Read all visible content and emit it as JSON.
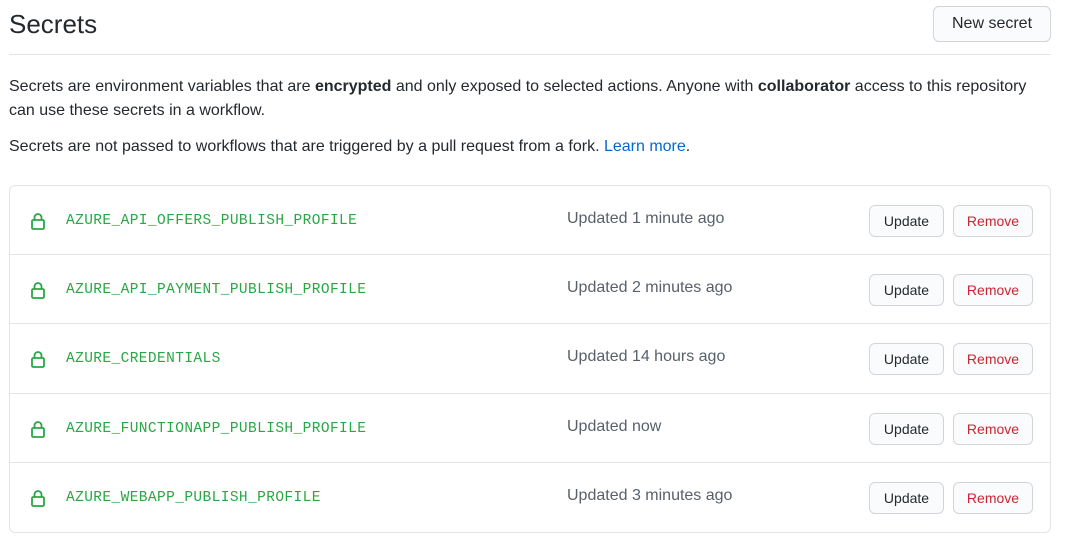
{
  "header": {
    "title": "Secrets",
    "new_secret_label": "New secret"
  },
  "description": {
    "p1_part1": "Secrets are environment variables that are ",
    "p1_bold1": "encrypted",
    "p1_part2": " and only exposed to selected actions. Anyone with ",
    "p1_bold2": "collaborator",
    "p1_part3": " access to this repository can use these secrets in a workflow.",
    "p2_text": "Secrets are not passed to workflows that are triggered by a pull request from a fork. ",
    "p2_link": "Learn more",
    "p2_end": "."
  },
  "secrets": [
    {
      "name": "AZURE_API_OFFERS_PUBLISH_PROFILE",
      "updated": "Updated 1 minute ago",
      "update_label": "Update",
      "remove_label": "Remove"
    },
    {
      "name": "AZURE_API_PAYMENT_PUBLISH_PROFILE",
      "updated": "Updated 2 minutes ago",
      "update_label": "Update",
      "remove_label": "Remove"
    },
    {
      "name": "AZURE_CREDENTIALS",
      "updated": "Updated 14 hours ago",
      "update_label": "Update",
      "remove_label": "Remove"
    },
    {
      "name": "AZURE_FUNCTIONAPP_PUBLISH_PROFILE",
      "updated": "Updated now",
      "update_label": "Update",
      "remove_label": "Remove"
    },
    {
      "name": "AZURE_WEBAPP_PUBLISH_PROFILE",
      "updated": "Updated 3 minutes ago",
      "update_label": "Update",
      "remove_label": "Remove"
    }
  ],
  "colors": {
    "secret_name": "#28a745",
    "remove_text": "#cb2431",
    "link": "#0366d6"
  },
  "icons": {
    "secret_row": "lock-icon"
  }
}
